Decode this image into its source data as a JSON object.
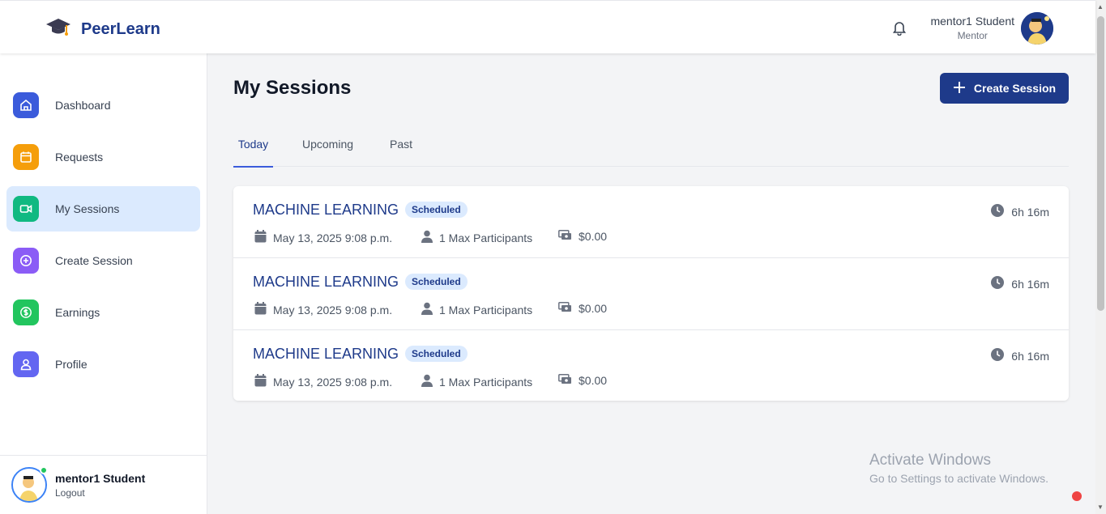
{
  "brand": {
    "name": "PeerLearn"
  },
  "header": {
    "user_name": "mentor1 Student",
    "user_role": "Mentor"
  },
  "sidebar": {
    "items": [
      {
        "label": "Dashboard",
        "icon": "home-icon",
        "color": "#3b5bdb"
      },
      {
        "label": "Requests",
        "icon": "calendar-icon",
        "color": "#f59e0b"
      },
      {
        "label": "My Sessions",
        "icon": "video-icon",
        "color": "#10b981"
      },
      {
        "label": "Create Session",
        "icon": "plus-circle-icon",
        "color": "#8b5cf6"
      },
      {
        "label": "Earnings",
        "icon": "dollar-icon",
        "color": "#22c55e"
      },
      {
        "label": "Profile",
        "icon": "user-icon",
        "color": "#6366f1"
      }
    ],
    "footer": {
      "user_name": "mentor1 Student",
      "logout_label": "Logout"
    }
  },
  "main": {
    "title": "My Sessions",
    "create_button_label": "Create Session",
    "tabs": [
      {
        "label": "Today",
        "active": true
      },
      {
        "label": "Upcoming",
        "active": false
      },
      {
        "label": "Past",
        "active": false
      }
    ],
    "sessions": [
      {
        "title": "MACHINE LEARNING",
        "status": "Scheduled",
        "date": "May 13, 2025 9:08 p.m.",
        "participants": "1 Max Participants",
        "price": "$0.00",
        "duration": "6h 16m"
      },
      {
        "title": "MACHINE LEARNING",
        "status": "Scheduled",
        "date": "May 13, 2025 9:08 p.m.",
        "participants": "1 Max Participants",
        "price": "$0.00",
        "duration": "6h 16m"
      },
      {
        "title": "MACHINE LEARNING",
        "status": "Scheduled",
        "date": "May 13, 2025 9:08 p.m.",
        "participants": "1 Max Participants",
        "price": "$0.00",
        "duration": "6h 16m"
      }
    ]
  },
  "watermark": {
    "line1": "Activate Windows",
    "line2": "Go to Settings to activate Windows."
  },
  "colors": {
    "primary": "#1e3a8a",
    "badge_bg": "#dbeafe",
    "active_nav_bg": "#dbeafe"
  }
}
